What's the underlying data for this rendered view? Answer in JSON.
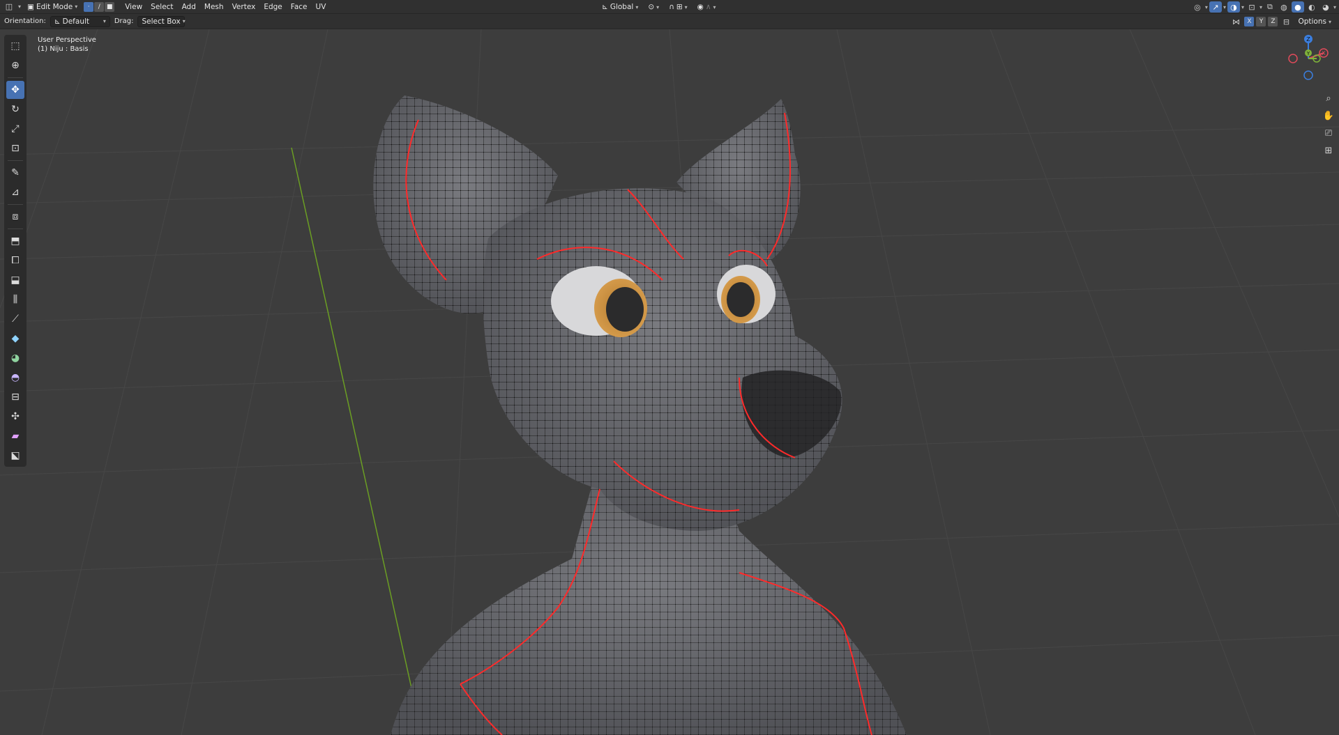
{
  "header": {
    "editor_type_icon": "view3d-icon",
    "mode_label": "Edit Mode",
    "menus": [
      "View",
      "Select",
      "Add",
      "Mesh",
      "Vertex",
      "Edge",
      "Face",
      "UV"
    ],
    "transform_orientation": "Global"
  },
  "tool_settings": {
    "orientation_label": "Orientation:",
    "orientation_value": "Default",
    "drag_label": "Drag:",
    "drag_value": "Select Box",
    "mirror_axes": [
      "X",
      "Y",
      "Z"
    ],
    "options_label": "Options"
  },
  "viewport": {
    "perspective_label": "User Perspective",
    "object_label": "(1) Niju : Basis"
  },
  "gizmo": {
    "axes": [
      "Z",
      "Y",
      "X"
    ]
  },
  "toolbar": {
    "tools": [
      "select-box-icon",
      "cursor-icon",
      "move-icon",
      "rotate-icon",
      "scale-icon",
      "transform-icon",
      "annotate-icon",
      "measure-icon",
      "add-cube-icon",
      "extrude-icon",
      "inset-icon",
      "bevel-icon",
      "loop-cut-icon",
      "knife-icon",
      "poly-build-icon",
      "spin-icon",
      "smooth-icon",
      "edge-slide-icon",
      "shrink-fatten-icon",
      "shear-icon",
      "rip-icon"
    ],
    "active_tool": "move-icon"
  },
  "colors": {
    "header_bg": "#303030",
    "viewport_bg": "#3d3d3d",
    "accent": "#4772b3",
    "seam_red": "#ff2a2a",
    "y_axis": "#6b9e23",
    "mesh_surface": "#6b6c70",
    "eye_iris": "#c98b3a"
  }
}
